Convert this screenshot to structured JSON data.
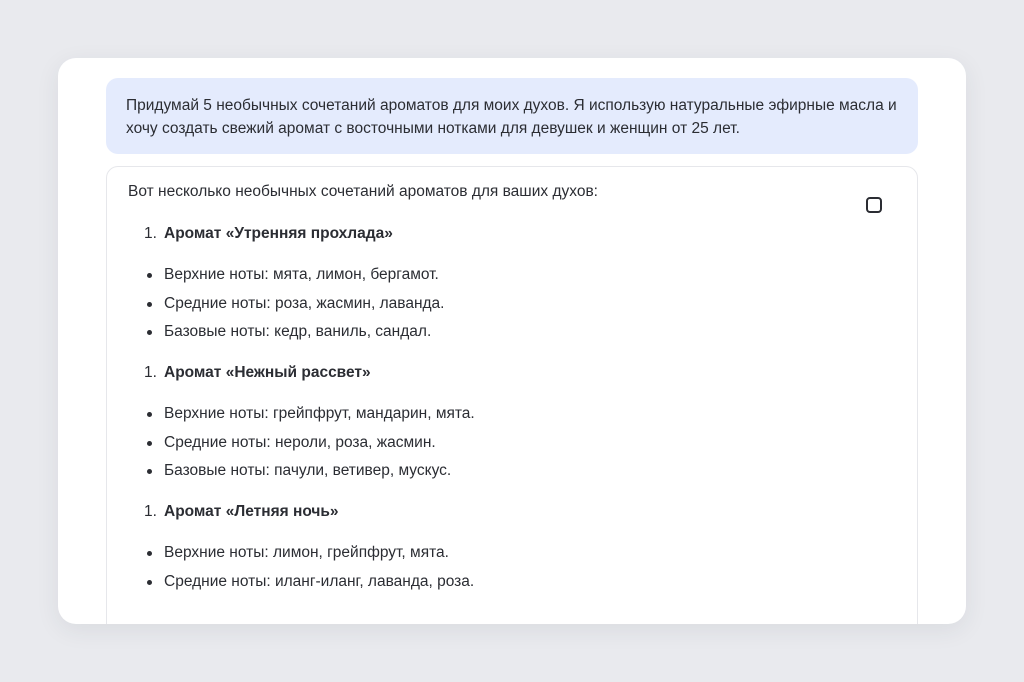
{
  "prompt": {
    "text": "Придумай 5 необычных сочетаний ароматов для моих духов. Я использую натуральные эфирные масла и хочу создать свежий аромат с восточными нотками для девушек и женщин от 25 лет."
  },
  "answer": {
    "intro": "Вот несколько необычных сочетаний ароматов для ваших духов:",
    "copy_icon": "copy-icon",
    "items": [
      {
        "number": "1.",
        "title": "Аромат «Утренняя прохлада»",
        "notes": [
          "Верхние ноты: мята, лимон, бергамот.",
          "Средние ноты: роза, жасмин, лаванда.",
          "Базовые ноты: кедр, ваниль, сандал."
        ]
      },
      {
        "number": "1.",
        "title": "Аромат «Нежный рассвет»",
        "notes": [
          "Верхние ноты: грейпфрут, мандарин, мята.",
          "Средние ноты: нероли, роза, жасмин.",
          "Базовые ноты: пачули, ветивер, мускус."
        ]
      },
      {
        "number": "1.",
        "title": "Аромат «Летняя ночь»",
        "notes": [
          "Верхние ноты: лимон, грейпфрут, мята.",
          "Средние ноты: иланг-иланг, лаванда, роза."
        ]
      }
    ]
  }
}
